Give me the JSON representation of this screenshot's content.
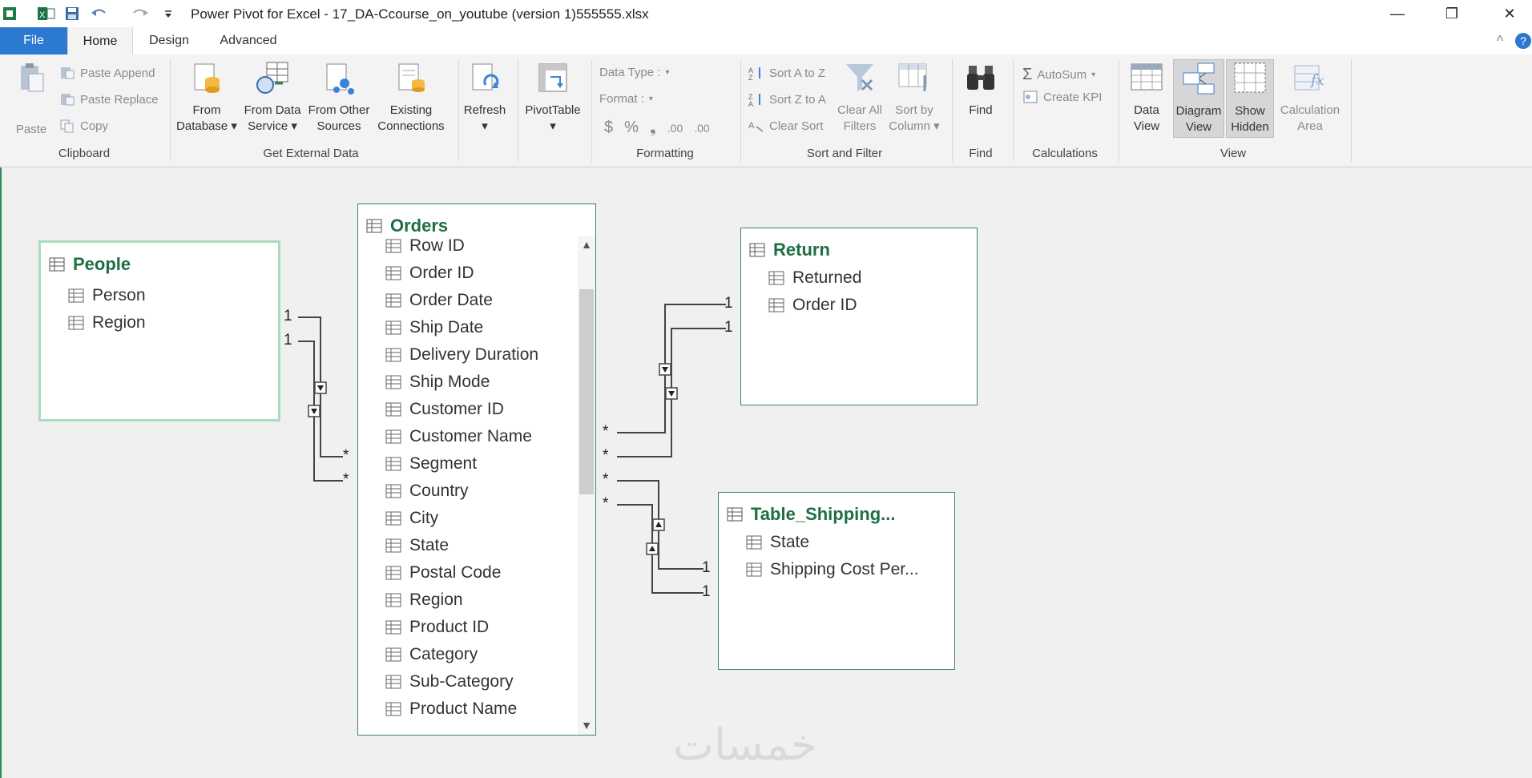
{
  "window": {
    "title": "Power Pivot for Excel - 17_DA-Ccourse_on_youtube (version 1)555555.xlsx",
    "minimize": "—",
    "restore": "❐",
    "close": "✕"
  },
  "menu": {
    "file": "File",
    "tabs": [
      {
        "label": "Home"
      },
      {
        "label": "Design"
      },
      {
        "label": "Advanced"
      }
    ],
    "collapse": "^",
    "help": "?"
  },
  "ribbon": {
    "clipboard": {
      "label": "Clipboard",
      "paste": "Paste",
      "paste_append": "Paste Append",
      "paste_replace": "Paste Replace",
      "copy": "Copy"
    },
    "external": {
      "label": "Get External Data",
      "from_database_1": "From",
      "from_database_2": "Database ▾",
      "from_data_service_1": "From Data",
      "from_data_service_2": "Service ▾",
      "from_other_1": "From Other",
      "from_other_2": "Sources",
      "existing_1": "Existing",
      "existing_2": "Connections"
    },
    "refresh": {
      "label": "Refresh",
      "arrow": "▾"
    },
    "pivot": {
      "label": "PivotTable",
      "arrow": "▾"
    },
    "formatting": {
      "label": "Formatting",
      "data_type": "Data Type :",
      "format": "Format :",
      "currency": "$",
      "percent": "%",
      "comma": "❟",
      "inc_dec": ".00",
      "dec_dec": ".00"
    },
    "sort": {
      "label": "Sort and Filter",
      "sort_az": "Sort A to Z",
      "sort_za": "Sort Z to A",
      "clear_sort": "Clear Sort",
      "clear_filters_1": "Clear All",
      "clear_filters_2": "Filters",
      "sort_by_1": "Sort by",
      "sort_by_2": "Column ▾"
    },
    "find": {
      "label": "Find",
      "button": "Find"
    },
    "calculations": {
      "label": "Calculations",
      "autosum": "AutoSum",
      "create_kpi": "Create KPI"
    },
    "view": {
      "label": "View",
      "data_view_1": "Data",
      "data_view_2": "View",
      "diagram_view_1": "Diagram",
      "diagram_view_2": "View",
      "show_hidden_1": "Show",
      "show_hidden_2": "Hidden",
      "calc_area_1": "Calculation",
      "calc_area_2": "Area"
    }
  },
  "diagram": {
    "people": {
      "title": "People",
      "columns": [
        "Person",
        "Region"
      ]
    },
    "orders": {
      "title": "Orders",
      "columns": [
        "Row ID",
        "Order ID",
        "Order Date",
        "Ship Date",
        "Delivery Duration",
        "Ship Mode",
        "Customer ID",
        "Customer Name",
        "Segment",
        "Country",
        "City",
        "State",
        "Postal Code",
        "Region",
        "Product ID",
        "Category",
        "Sub-Category",
        "Product Name"
      ]
    },
    "return": {
      "title": "Return",
      "columns": [
        "Returned",
        "Order ID"
      ]
    },
    "shipping": {
      "title": "Table_Shipping...",
      "columns": [
        "State",
        "Shipping Cost Per..."
      ]
    },
    "rel_one": "1",
    "rel_many": "*"
  },
  "watermark": "خمسات"
}
